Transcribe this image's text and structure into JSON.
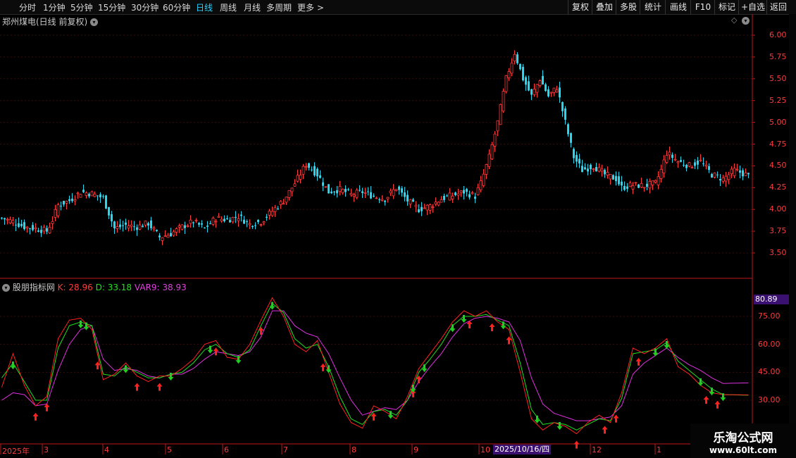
{
  "toolbar": {
    "timeframes": [
      {
        "label": "分时",
        "active": false
      },
      {
        "label": "1分钟",
        "active": false
      },
      {
        "label": "5分钟",
        "active": false
      },
      {
        "label": "15分钟",
        "active": false
      },
      {
        "label": "30分钟",
        "active": false
      },
      {
        "label": "60分钟",
        "active": false
      },
      {
        "label": "日线",
        "active": true
      },
      {
        "label": "周线",
        "active": false
      },
      {
        "label": "月线",
        "active": false
      },
      {
        "label": "多周期",
        "active": false
      },
      {
        "label": "更多 >",
        "active": false
      }
    ],
    "tools": [
      "复权",
      "叠加",
      "多股",
      "统计",
      "画线",
      "F10",
      "标记",
      "+自选",
      "返回"
    ]
  },
  "stock": {
    "title": "郑州煤电(日线 前复权)"
  },
  "indicator": {
    "name": "股朋指标网",
    "k": "K: 28.96",
    "d": "D: 33.18",
    "var9": "VAR9: 38.93",
    "current_label": "80.89"
  },
  "colors": {
    "up": "#ff3b3b",
    "down": "#23d8f0",
    "k_line": "#ff2020",
    "d_line": "#20e020",
    "var9_line": "#e030e0",
    "buy_arrow": "#ff2020",
    "sell_arrow": "#20d020"
  },
  "price_axis": [
    "6.00",
    "5.75",
    "5.50",
    "5.25",
    "5.00",
    "4.75",
    "4.50",
    "4.25",
    "4.00",
    "3.75",
    "3.50"
  ],
  "indicator_axis": [
    "75.00",
    "60.00",
    "45.00",
    "30.00"
  ],
  "x_axis": [
    "2025年",
    "3",
    "4",
    "5",
    "6",
    "7",
    "8",
    "9",
    "10",
    "12",
    "1"
  ],
  "cursor_date": "2025/10/16/四",
  "watermark": {
    "line1": "乐淘公式网",
    "line2": "www.60lt.com"
  },
  "chart_data": {
    "type": "candlestick",
    "price_ylim": [
      3.3,
      6.1
    ],
    "price_anchors": [
      [
        0,
        3.9
      ],
      [
        4,
        3.86
      ],
      [
        8,
        3.8
      ],
      [
        12,
        3.78
      ],
      [
        16,
        3.75
      ],
      [
        18,
        3.88
      ],
      [
        20,
        4.05
      ],
      [
        24,
        4.1
      ],
      [
        28,
        4.2
      ],
      [
        32,
        4.18
      ],
      [
        36,
        4.13
      ],
      [
        40,
        3.78
      ],
      [
        44,
        3.82
      ],
      [
        48,
        3.8
      ],
      [
        52,
        3.84
      ],
      [
        56,
        3.68
      ],
      [
        60,
        3.72
      ],
      [
        64,
        3.8
      ],
      [
        68,
        3.86
      ],
      [
        72,
        3.78
      ],
      [
        76,
        3.9
      ],
      [
        80,
        3.88
      ],
      [
        84,
        3.92
      ],
      [
        88,
        3.83
      ],
      [
        92,
        3.86
      ],
      [
        96,
        3.98
      ],
      [
        100,
        4.1
      ],
      [
        104,
        4.3
      ],
      [
        108,
        4.52
      ],
      [
        112,
        4.4
      ],
      [
        116,
        4.2
      ],
      [
        120,
        4.23
      ],
      [
        124,
        4.17
      ],
      [
        128,
        4.2
      ],
      [
        132,
        4.15
      ],
      [
        136,
        4.12
      ],
      [
        140,
        4.25
      ],
      [
        144,
        4.1
      ],
      [
        148,
        4.0
      ],
      [
        152,
        4.04
      ],
      [
        156,
        4.12
      ],
      [
        160,
        4.16
      ],
      [
        164,
        4.2
      ],
      [
        168,
        4.15
      ],
      [
        170,
        4.3
      ],
      [
        173,
        4.6
      ],
      [
        176,
        5.0
      ],
      [
        179,
        5.5
      ],
      [
        182,
        5.8
      ],
      [
        185,
        5.5
      ],
      [
        188,
        5.3
      ],
      [
        191,
        5.5
      ],
      [
        194,
        5.3
      ],
      [
        197,
        5.4
      ],
      [
        200,
        5.0
      ],
      [
        203,
        4.6
      ],
      [
        206,
        4.45
      ],
      [
        210,
        4.5
      ],
      [
        214,
        4.4
      ],
      [
        218,
        4.35
      ],
      [
        220,
        4.25
      ],
      [
        224,
        4.28
      ],
      [
        228,
        4.27
      ],
      [
        232,
        4.3
      ],
      [
        234,
        4.45
      ],
      [
        236,
        4.65
      ],
      [
        240,
        4.55
      ],
      [
        244,
        4.5
      ],
      [
        248,
        4.55
      ],
      [
        252,
        4.4
      ],
      [
        256,
        4.35
      ],
      [
        260,
        4.45
      ],
      [
        264,
        4.4
      ],
      [
        265,
        4.38
      ]
    ],
    "k_anchors": [
      [
        0,
        37
      ],
      [
        4,
        55
      ],
      [
        8,
        38
      ],
      [
        12,
        27
      ],
      [
        16,
        32
      ],
      [
        20,
        63
      ],
      [
        24,
        73
      ],
      [
        28,
        74
      ],
      [
        32,
        68
      ],
      [
        36,
        41
      ],
      [
        40,
        44
      ],
      [
        44,
        50
      ],
      [
        48,
        43
      ],
      [
        52,
        40
      ],
      [
        56,
        43
      ],
      [
        60,
        43
      ],
      [
        64,
        47
      ],
      [
        68,
        52
      ],
      [
        72,
        60
      ],
      [
        76,
        62
      ],
      [
        80,
        53
      ],
      [
        84,
        52
      ],
      [
        88,
        60
      ],
      [
        92,
        73
      ],
      [
        96,
        85
      ],
      [
        100,
        75
      ],
      [
        104,
        60
      ],
      [
        108,
        56
      ],
      [
        112,
        62
      ],
      [
        116,
        45
      ],
      [
        120,
        28
      ],
      [
        124,
        18
      ],
      [
        128,
        15
      ],
      [
        132,
        27
      ],
      [
        136,
        24
      ],
      [
        140,
        20
      ],
      [
        144,
        32
      ],
      [
        148,
        47
      ],
      [
        152,
        55
      ],
      [
        156,
        63
      ],
      [
        160,
        72
      ],
      [
        164,
        78
      ],
      [
        168,
        75
      ],
      [
        172,
        78
      ],
      [
        176,
        72
      ],
      [
        180,
        68
      ],
      [
        184,
        45
      ],
      [
        188,
        20
      ],
      [
        192,
        14
      ],
      [
        196,
        18
      ],
      [
        200,
        16
      ],
      [
        204,
        12
      ],
      [
        208,
        18
      ],
      [
        212,
        22
      ],
      [
        216,
        18
      ],
      [
        220,
        34
      ],
      [
        224,
        58
      ],
      [
        228,
        55
      ],
      [
        232,
        58
      ],
      [
        236,
        63
      ],
      [
        240,
        48
      ],
      [
        244,
        44
      ],
      [
        248,
        38
      ],
      [
        252,
        34
      ],
      [
        256,
        33
      ]
    ],
    "d_anchors": [
      [
        0,
        42
      ],
      [
        4,
        50
      ],
      [
        8,
        40
      ],
      [
        12,
        30
      ],
      [
        16,
        30
      ],
      [
        20,
        58
      ],
      [
        24,
        70
      ],
      [
        28,
        72
      ],
      [
        32,
        70
      ],
      [
        36,
        44
      ],
      [
        40,
        43
      ],
      [
        44,
        48
      ],
      [
        48,
        45
      ],
      [
        52,
        42
      ],
      [
        56,
        42
      ],
      [
        60,
        44
      ],
      [
        64,
        45
      ],
      [
        68,
        50
      ],
      [
        72,
        57
      ],
      [
        76,
        60
      ],
      [
        80,
        55
      ],
      [
        84,
        53
      ],
      [
        88,
        57
      ],
      [
        92,
        70
      ],
      [
        96,
        82
      ],
      [
        100,
        77
      ],
      [
        104,
        63
      ],
      [
        108,
        58
      ],
      [
        112,
        60
      ],
      [
        116,
        48
      ],
      [
        120,
        32
      ],
      [
        124,
        20
      ],
      [
        128,
        17
      ],
      [
        132,
        24
      ],
      [
        136,
        25
      ],
      [
        140,
        22
      ],
      [
        144,
        30
      ],
      [
        148,
        45
      ],
      [
        152,
        52
      ],
      [
        156,
        60
      ],
      [
        160,
        70
      ],
      [
        164,
        75
      ],
      [
        168,
        75
      ],
      [
        172,
        76
      ],
      [
        176,
        73
      ],
      [
        180,
        70
      ],
      [
        184,
        50
      ],
      [
        188,
        25
      ],
      [
        192,
        17
      ],
      [
        196,
        18
      ],
      [
        200,
        17
      ],
      [
        204,
        14
      ],
      [
        208,
        17
      ],
      [
        212,
        20
      ],
      [
        216,
        19
      ],
      [
        220,
        31
      ],
      [
        224,
        55
      ],
      [
        228,
        56
      ],
      [
        232,
        57
      ],
      [
        236,
        61
      ],
      [
        240,
        51
      ],
      [
        244,
        46
      ],
      [
        248,
        41
      ],
      [
        252,
        36
      ],
      [
        256,
        33
      ]
    ],
    "var9_anchors": [
      [
        0,
        30
      ],
      [
        4,
        34
      ],
      [
        8,
        33
      ],
      [
        12,
        27
      ],
      [
        16,
        28
      ],
      [
        20,
        46
      ],
      [
        24,
        60
      ],
      [
        28,
        68
      ],
      [
        32,
        70
      ],
      [
        36,
        52
      ],
      [
        40,
        46
      ],
      [
        44,
        47
      ],
      [
        48,
        46
      ],
      [
        52,
        43
      ],
      [
        56,
        42
      ],
      [
        60,
        44
      ],
      [
        64,
        44
      ],
      [
        68,
        47
      ],
      [
        72,
        52
      ],
      [
        76,
        56
      ],
      [
        80,
        55
      ],
      [
        84,
        54
      ],
      [
        88,
        56
      ],
      [
        92,
        64
      ],
      [
        96,
        78
      ],
      [
        100,
        78
      ],
      [
        104,
        70
      ],
      [
        108,
        66
      ],
      [
        112,
        64
      ],
      [
        116,
        55
      ],
      [
        120,
        42
      ],
      [
        124,
        30
      ],
      [
        128,
        22
      ],
      [
        132,
        24
      ],
      [
        136,
        26
      ],
      [
        140,
        25
      ],
      [
        144,
        30
      ],
      [
        148,
        40
      ],
      [
        152,
        48
      ],
      [
        156,
        55
      ],
      [
        160,
        64
      ],
      [
        164,
        71
      ],
      [
        168,
        74
      ],
      [
        172,
        75
      ],
      [
        176,
        74
      ],
      [
        180,
        72
      ],
      [
        184,
        62
      ],
      [
        188,
        42
      ],
      [
        192,
        28
      ],
      [
        196,
        23
      ],
      [
        200,
        21
      ],
      [
        204,
        19
      ],
      [
        208,
        19
      ],
      [
        212,
        20
      ],
      [
        216,
        21
      ],
      [
        220,
        27
      ],
      [
        224,
        44
      ],
      [
        228,
        50
      ],
      [
        232,
        54
      ],
      [
        236,
        58
      ],
      [
        240,
        53
      ],
      [
        244,
        49
      ],
      [
        248,
        46
      ],
      [
        252,
        42
      ],
      [
        256,
        39
      ]
    ],
    "buy_signals": [
      12,
      16,
      34,
      48,
      56,
      76,
      92,
      114,
      132,
      146,
      148,
      166,
      174,
      180,
      204,
      214,
      218,
      226,
      250,
      254
    ],
    "sell_signals": [
      4,
      28,
      30,
      44,
      60,
      74,
      84,
      96,
      116,
      138,
      146,
      150,
      160,
      164,
      178,
      190,
      198,
      232,
      236,
      248,
      252,
      256
    ]
  }
}
